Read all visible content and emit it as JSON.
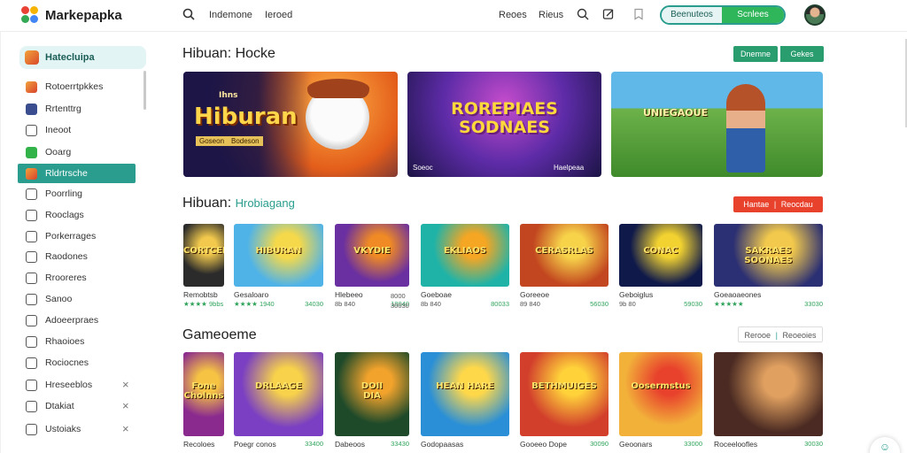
{
  "topbar": {
    "brand": "Markepapka",
    "nav": [
      "Indemone",
      "Ieroed"
    ],
    "right_links": [
      "Reoes",
      "Rieus"
    ],
    "pill_left": "Beenuteos",
    "pill_right": "Scnlees",
    "icons": [
      "search-icon",
      "search-icon",
      "edit-icon",
      "bookmark-icon"
    ]
  },
  "sidebar": {
    "header": "Hatecluipa",
    "items": [
      {
        "label": "Rotoerrtpkkes",
        "icon": "game-icon",
        "closable": false
      },
      {
        "label": "Rrtenttrg",
        "icon": "user-icon",
        "closable": false
      },
      {
        "label": "Ineoot",
        "icon": "checkbox-icon",
        "closable": false
      },
      {
        "label": "Ooarg",
        "icon": "money-icon",
        "closable": false
      },
      {
        "label": "Rldrtrsche",
        "icon": "game-icon",
        "closable": false,
        "active": true
      },
      {
        "label": "Poorrling",
        "icon": "folder-icon",
        "closable": false
      },
      {
        "label": "Rooclags",
        "icon": "folder-icon",
        "closable": false
      },
      {
        "label": "Porkerrages",
        "icon": "folder-icon",
        "closable": false
      },
      {
        "label": "Raodones",
        "icon": "folder-icon",
        "closable": false
      },
      {
        "label": "Rrooreres",
        "icon": "folder-icon",
        "closable": false
      },
      {
        "label": "Sanoo",
        "icon": "tag-icon",
        "closable": false
      },
      {
        "label": "Adoeerpraes",
        "icon": "star-icon",
        "closable": false
      },
      {
        "label": "Rhaoioes",
        "icon": "folder-icon",
        "closable": false
      },
      {
        "label": "Rociocnes",
        "icon": "grid-icon",
        "closable": false
      },
      {
        "label": "Hreseeblos",
        "icon": "folder-icon",
        "closable": true
      },
      {
        "label": "Dtakiat",
        "icon": "folder-icon",
        "closable": true
      },
      {
        "label": "Ustoiaks",
        "icon": "bell-icon",
        "closable": true
      }
    ]
  },
  "section1": {
    "title": "Hibuan: Hocke",
    "btn_left": "Dnemne",
    "btn_right": "Gekes",
    "banners": [
      {
        "title": "Hiburan",
        "kicker": "Ihns",
        "sub1": "Goseon",
        "sub2": "Bodeson"
      },
      {
        "title": "ROREPIAES\nSODNAES",
        "sub1": "Soeoc",
        "sub2": "Haelpeaa"
      },
      {
        "title": "UNIEGAOUE"
      }
    ]
  },
  "section2": {
    "title": "Hibuan:",
    "title_accent": "Hrobiagang",
    "btn_left": "Hantae",
    "btn_right": "Reocdau",
    "cards": [
      {
        "thumb": "CORTCEIE",
        "name": "Remobtsb",
        "meta": "★★★★ 9bbs",
        "price": ""
      },
      {
        "thumb": "HIBURAN",
        "name": "Gesaloaro",
        "meta": "★★★★ 1940",
        "price": "34030"
      },
      {
        "thumb": "VKYDIE",
        "name": "Hlebeeo",
        "meta": "8b 840",
        "price": "18040"
      },
      {
        "thumb": "EKLIAOS",
        "name": "Goeboae",
        "meta": "8b 840",
        "price": "80033"
      },
      {
        "thumb": "CERASRLAS",
        "name": "Goreeoe",
        "meta": "89 840",
        "price": "56030"
      },
      {
        "thumb": "CONAC",
        "name": "Geboiglus",
        "meta": "9b 80",
        "price": "59030"
      },
      {
        "thumb": "SAKRAES\nSOONAES",
        "name": "Goeaoaeones",
        "meta": "★★★★★",
        "price": "33030"
      }
    ],
    "extra_prices": [
      "8000",
      "30030"
    ]
  },
  "section3": {
    "title": "Gameoeme",
    "btn_left": "Rerooe",
    "btn_right": "Reoeoies",
    "cards": [
      {
        "thumb": "Fone\nCholnns",
        "name": "Recoloes",
        "price": ""
      },
      {
        "thumb": "DRLAAGE",
        "name": "Poegr conos",
        "price": "33400"
      },
      {
        "thumb": "DOII\nDIA",
        "name": "Dabeoos",
        "price": "33430"
      },
      {
        "thumb": "HEAN HARE",
        "name": "Godopaasas",
        "price": ""
      },
      {
        "thumb": "BETHMUIGES",
        "name": "Gooeeo Dope",
        "price": "30090"
      },
      {
        "thumb": "Oosermstus",
        "name": "Geoonars",
        "price": "33000"
      },
      {
        "thumb": "",
        "name": "Roceeloofles",
        "price": "30030"
      }
    ]
  }
}
